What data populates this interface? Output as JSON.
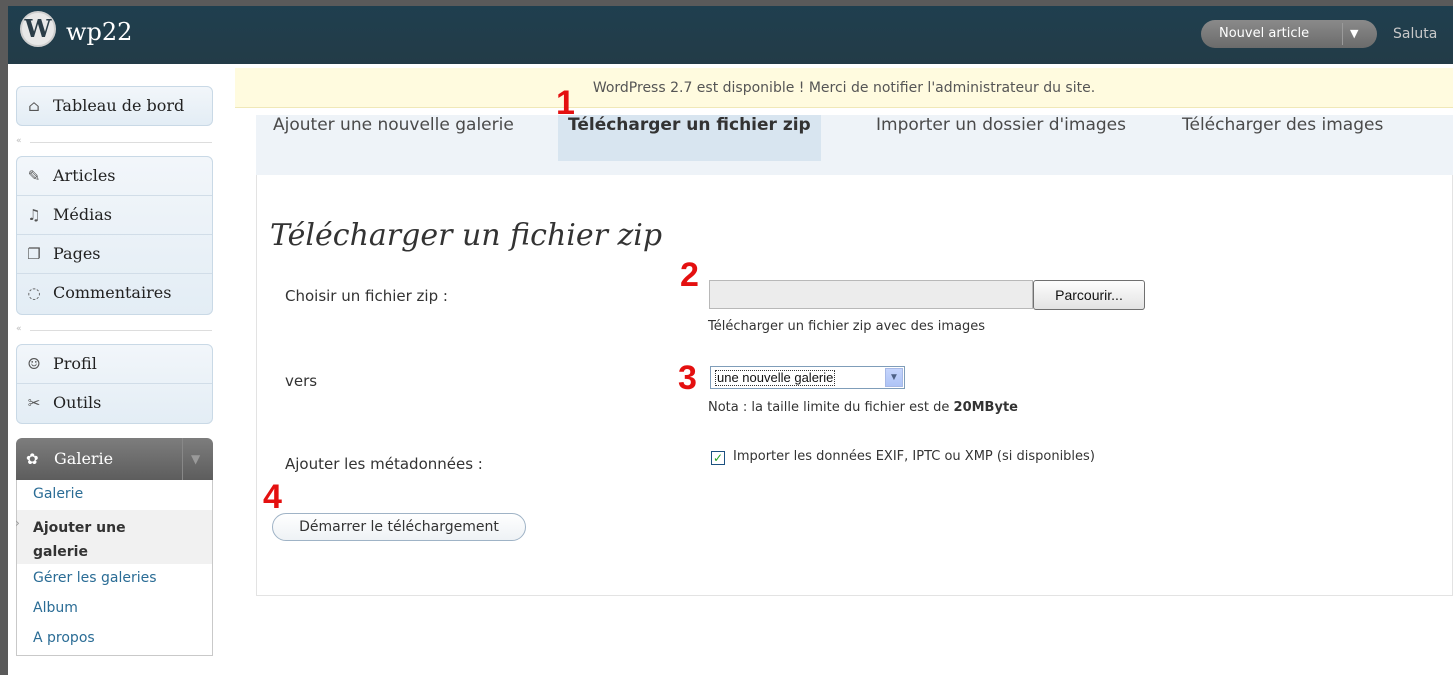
{
  "header": {
    "logo": "W",
    "site_name": "wp22",
    "new_post_label": "Nouvel article",
    "greeting": "Saluta"
  },
  "sidebar": {
    "dashboard": "Tableau de bord",
    "items_group1": [
      "Articles",
      "Médias",
      "Pages",
      "Commentaires"
    ],
    "items_group2": [
      "Profil",
      "Outils"
    ],
    "gallery": {
      "label": "Galerie",
      "submenu": [
        "Galerie",
        "Ajouter une galerie",
        "Gérer les galeries",
        "Album",
        "A propos"
      ]
    }
  },
  "notice": "WordPress 2.7 est disponible ! Merci de notifier l'administrateur du site.",
  "tabs": [
    "Ajouter une nouvelle galerie",
    "Télécharger un fichier zip",
    "Importer un dossier d'images",
    "Télécharger des images"
  ],
  "form": {
    "title": "Télécharger un fichier zip",
    "file_label": "Choisir un fichier zip :",
    "browse_label": "Parcourir...",
    "file_help": "Télécharger un fichier zip avec des images",
    "to_label": "vers",
    "select_value": "une nouvelle galerie",
    "size_note_prefix": "Nota : la taille limite du fichier est de ",
    "size_note_value": "20MByte",
    "metadata_label": "Ajouter les métadonnées :",
    "metadata_checkbox": "Importer les données EXIF, IPTC ou XMP (si disponibles)",
    "start_button": "Démarrer le téléchargement"
  },
  "annotations": [
    "1",
    "2",
    "3",
    "4"
  ]
}
